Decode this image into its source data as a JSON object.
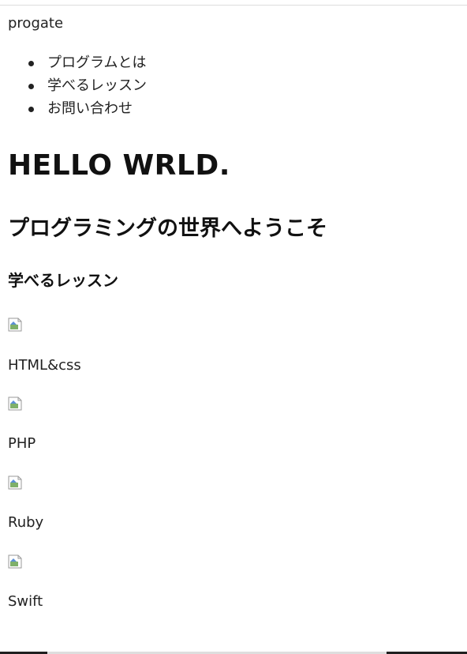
{
  "header": {
    "logo_text": "progate"
  },
  "nav": {
    "items": [
      {
        "label": "プログラムとは"
      },
      {
        "label": "学べるレッスン"
      },
      {
        "label": "お問い合わせ"
      }
    ]
  },
  "main": {
    "title": "HELLO WRLD.",
    "subtitle": "プログラミングの世界へようこそ",
    "section_heading": "学べるレッスン",
    "lessons": [
      {
        "label": "HTML&css",
        "image_icon": "broken-image-icon"
      },
      {
        "label": "PHP",
        "image_icon": "broken-image-icon"
      },
      {
        "label": "Ruby",
        "image_icon": "broken-image-icon"
      },
      {
        "label": "Swift",
        "image_icon": "broken-image-icon"
      }
    ]
  },
  "colors": {
    "text": "#222222",
    "background": "#ffffff"
  }
}
